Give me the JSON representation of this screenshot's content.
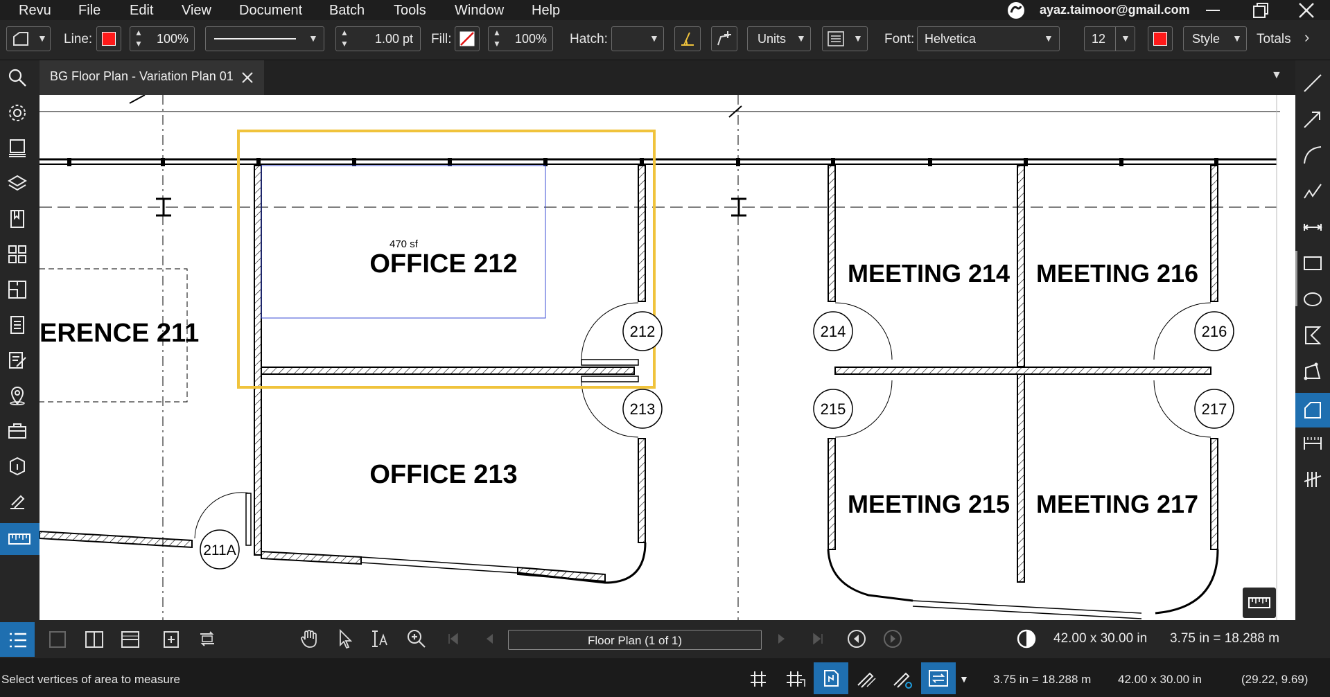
{
  "menu": {
    "items": [
      "Revu",
      "File",
      "Edit",
      "View",
      "Document",
      "Batch",
      "Tools",
      "Window",
      "Help"
    ],
    "account_email": "ayaz.taimoor@gmail.com"
  },
  "toolbar": {
    "line_label": "Line:",
    "line_opacity": "100%",
    "line_width": "1.00 pt",
    "fill_label": "Fill:",
    "fill_opacity": "100%",
    "hatch_label": "Hatch:",
    "units_label": "Units",
    "font_label": "Font:",
    "font_name": "Helvetica",
    "font_size": "12",
    "style_label": "Style",
    "totals_label": "Totals",
    "line_color": "#ff1a1a",
    "text_color": "#ff1a1a"
  },
  "tab": {
    "title": "BG Floor Plan - Variation Plan 01"
  },
  "drawing": {
    "rooms": {
      "office_212_area": "470 sf",
      "office_212": "OFFICE  212",
      "office_213": "OFFICE  213",
      "conference_211": "ERENCE  211",
      "meeting_214": "MEETING  214",
      "meeting_216": "MEETING  216",
      "meeting_215": "MEETING  215",
      "meeting_217": "MEETING  217"
    },
    "door_tags": [
      "212",
      "213",
      "214",
      "215",
      "216",
      "217",
      "211A"
    ]
  },
  "bottom_nav": {
    "page_label": "Floor Plan (1 of 1)",
    "page_size": "42.00 x 30.00 in",
    "scale": "3.75 in = 18.288 m"
  },
  "status": {
    "prompt": "Select vertices of area to measure",
    "scale": "3.75 in = 18.288 m",
    "page_size": "42.00 x 30.00 in",
    "cursor": "(29.22, 9.69)"
  },
  "colors": {
    "accent": "#1f6fb0",
    "highlight": "#f0c33c",
    "measure_outline": "#3a4bd6"
  }
}
